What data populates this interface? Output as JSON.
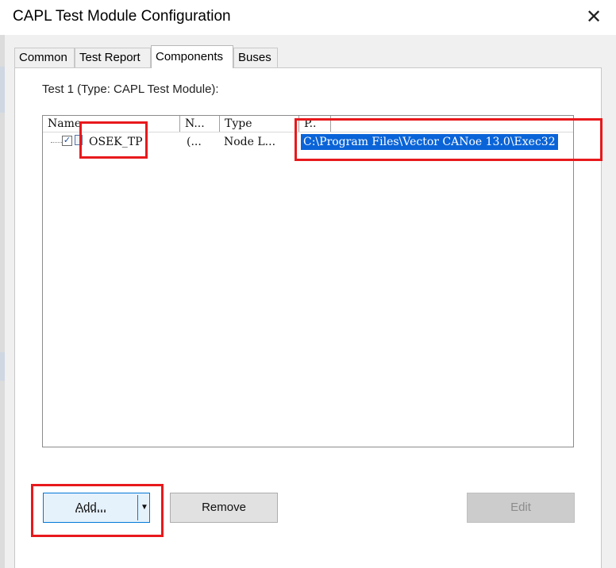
{
  "window": {
    "title": "CAPL Test Module Configuration",
    "close_icon": "close-icon"
  },
  "tabs": [
    {
      "label": "Common"
    },
    {
      "label": "Test Report"
    },
    {
      "label": "Components",
      "active": true
    },
    {
      "label": "Buses"
    }
  ],
  "components": {
    "group_label": "Test 1 (Type: CAPL Test Module):",
    "columns": [
      "Name",
      "N...",
      "Type",
      "P.."
    ],
    "rows": [
      {
        "checked": true,
        "name": "OSEK_TP",
        "n": "(...",
        "type": "Node L...",
        "path": "C:\\Program Files\\Vector CANoe 13.0\\Exec32"
      }
    ]
  },
  "buttons": {
    "add": "Add...",
    "remove": "Remove",
    "edit": "Edit"
  },
  "colors": {
    "selection": "#0a64d8",
    "highlight_box": "#e8191c"
  }
}
